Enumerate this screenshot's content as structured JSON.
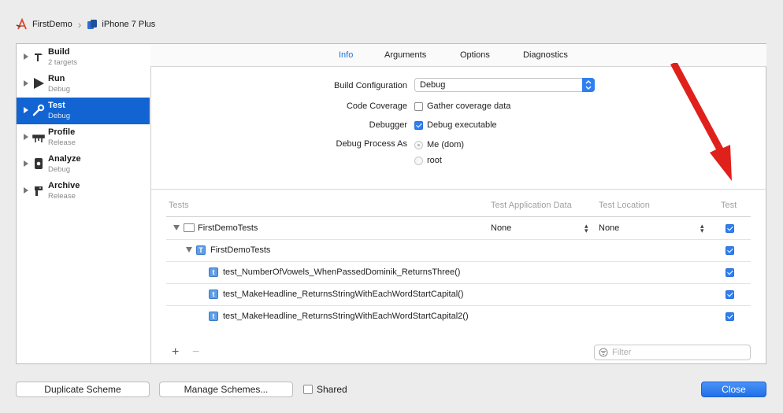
{
  "breadcrumb": {
    "project": "FirstDemo",
    "device": "iPhone 7 Plus"
  },
  "sidebar": {
    "items": [
      {
        "title": "Build",
        "subtitle": "2 targets",
        "icon": "hammer-icon"
      },
      {
        "title": "Run",
        "subtitle": "Debug",
        "icon": "play-icon"
      },
      {
        "title": "Test",
        "subtitle": "Debug",
        "icon": "wrench-icon",
        "selected": true
      },
      {
        "title": "Profile",
        "subtitle": "Release",
        "icon": "instruments-icon"
      },
      {
        "title": "Analyze",
        "subtitle": "Debug",
        "icon": "analyze-icon"
      },
      {
        "title": "Archive",
        "subtitle": "Release",
        "icon": "archive-icon"
      }
    ]
  },
  "tabs": [
    {
      "label": "Info",
      "active": true
    },
    {
      "label": "Arguments"
    },
    {
      "label": "Options"
    },
    {
      "label": "Diagnostics"
    }
  ],
  "info": {
    "build_configuration_label": "Build Configuration",
    "build_configuration_value": "Debug",
    "code_coverage_label": "Code Coverage",
    "code_coverage_option": "Gather coverage data",
    "debugger_label": "Debugger",
    "debugger_option": "Debug executable",
    "debug_process_as_label": "Debug Process As",
    "debug_process_option_1": "Me (dom)",
    "debug_process_option_2": "root"
  },
  "tests_table": {
    "columns": {
      "tests": "Tests",
      "app_data": "Test Application Data",
      "location": "Test Location",
      "test": "Test"
    },
    "rows": [
      {
        "name": "FirstDemoTests",
        "app_data": "None",
        "location": "None"
      },
      {
        "name": "FirstDemoTests"
      },
      {
        "name": "test_NumberOfVowels_WhenPassedDominik_ReturnsThree()"
      },
      {
        "name": "test_MakeHeadline_ReturnsStringWithEachWordStartCapital()"
      },
      {
        "name": "test_MakeHeadline_ReturnsStringWithEachWordStartCapital2()"
      }
    ],
    "add_symbol": "+",
    "remove_symbol": "−",
    "filter_placeholder": "Filter"
  },
  "footer": {
    "duplicate": "Duplicate Scheme",
    "manage": "Manage Schemes...",
    "shared": "Shared",
    "close": "Close"
  },
  "colors": {
    "accent": "#1164d2",
    "annotation_arrow": "#e0201b"
  }
}
